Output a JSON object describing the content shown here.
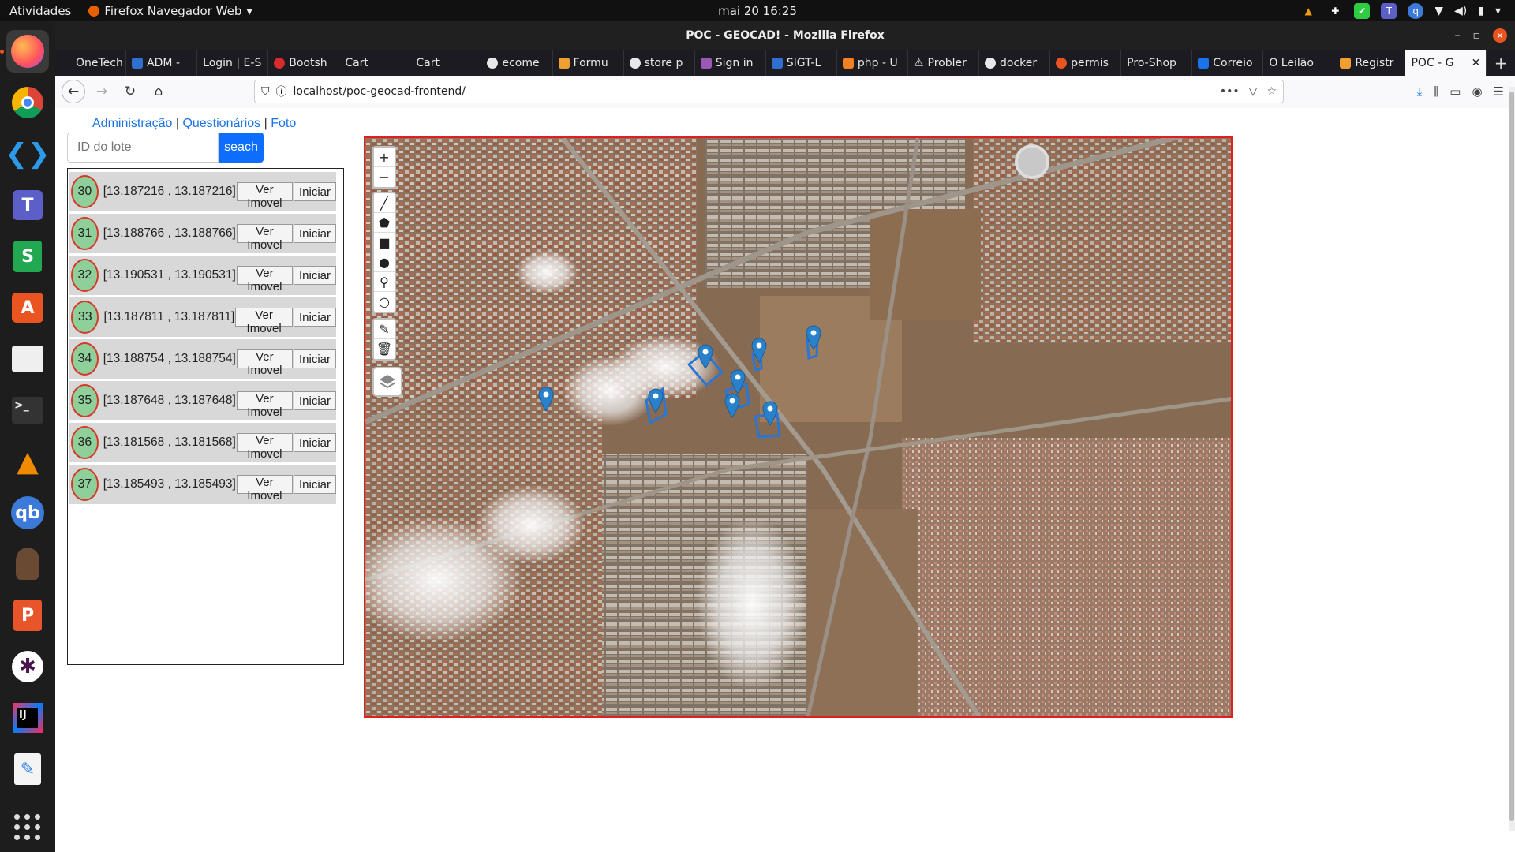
{
  "topbar": {
    "activities": "Atividades",
    "app_name": "Firefox Navegador Web",
    "clock": "mai 20  16:25"
  },
  "window": {
    "title": "POC - GEOCAD! - Mozilla Firefox"
  },
  "tabs": [
    {
      "label": "OneTech",
      "color": "#1c1b22"
    },
    {
      "label": "ADM -",
      "color": "#2f6fcf"
    },
    {
      "label": "Login | E-S",
      "color": "#1c1b22"
    },
    {
      "label": "Bootsh",
      "color": "#d92b2b"
    },
    {
      "label": "Cart",
      "color": "#1c1b22"
    },
    {
      "label": "Cart",
      "color": "#1c1b22"
    },
    {
      "label": "ecome",
      "color": "#e8e8e8"
    },
    {
      "label": "Formu",
      "color": "#f0a030"
    },
    {
      "label": "store p",
      "color": "#e8e8e8"
    },
    {
      "label": "Sign in",
      "color": "#9b59b6"
    },
    {
      "label": "SIGT-L",
      "color": "#2f6fcf"
    },
    {
      "label": "php - U",
      "color": "#f48024"
    },
    {
      "label": "Probler",
      "color": "#cccccc"
    },
    {
      "label": "docker",
      "color": "#e8e8e8"
    },
    {
      "label": "permis",
      "color": "#e95420"
    },
    {
      "label": "Pro-Shop",
      "color": "#1c1b22"
    },
    {
      "label": "Correio",
      "color": "#1a73e8"
    },
    {
      "label": "O Leilão",
      "color": "#1c1b22"
    },
    {
      "label": "Registr",
      "color": "#f0a030"
    },
    {
      "label": "POC - G",
      "color": "#f9f9fb"
    }
  ],
  "navbar": {
    "url": "localhost/poc-geocad-frontend/"
  },
  "page": {
    "links": {
      "admin": "Administração",
      "separator": "|",
      "questionarios": "Questionários",
      "foto": "Foto"
    },
    "search": {
      "placeholder": "ID do lote",
      "button": "seach"
    },
    "lotes": [
      {
        "id": "30",
        "coords": "[13.187216 , 13.187216]"
      },
      {
        "id": "31",
        "coords": "[13.188766 , 13.188766]"
      },
      {
        "id": "32",
        "coords": "[13.190531 , 13.190531]"
      },
      {
        "id": "33",
        "coords": "[13.187811 , 13.187811]"
      },
      {
        "id": "34",
        "coords": "[13.188754 , 13.188754]"
      },
      {
        "id": "35",
        "coords": "[13.187648 , 13.187648]"
      },
      {
        "id": "36",
        "coords": "[13.181568 , 13.181568]"
      },
      {
        "id": "37",
        "coords": "[13.185493 , 13.185493]"
      }
    ],
    "buttons": {
      "ver": "Ver Imovel",
      "iniciar": "Iniciar"
    }
  },
  "map": {
    "zoom_in": "+",
    "zoom_out": "−"
  }
}
